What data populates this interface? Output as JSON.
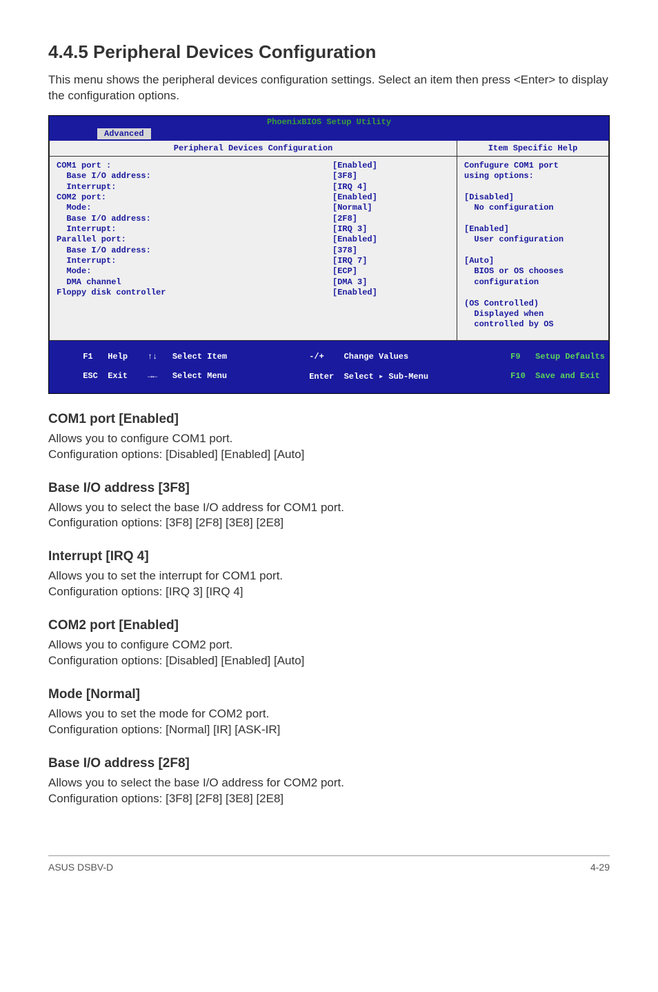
{
  "heading": "4.4.5      Peripheral Devices Configuration",
  "intro": "This menu shows the peripheral devices configuration settings.  Select an item then press <Enter> to display the configuration options.",
  "bios": {
    "title": "PhoenixBIOS Setup Utility",
    "tab": "Advanced",
    "left_header": "Peripheral Devices Configuration",
    "right_header": "Item Specific Help",
    "labels": "COM1 port :\n  Base I/O address:\n  Interrupt:\nCOM2 port:\n  Mode:\n  Base I/O address:\n  Interrupt:\nParallel port:\n  Base I/O address:\n  Interrupt:\n  Mode:\n  DMA channel\nFloppy disk controller",
    "values": "[Enabled]\n[3F8]\n[IRQ 4]\n[Enabled]\n[Normal]\n[2F8]\n[IRQ 3]\n[Enabled]\n[378]\n[IRQ 7]\n[ECP]\n[DMA 3]\n[Enabled]",
    "help": "Confugure COM1 port\nusing options:\n\n[Disabled]\n  No configuration\n\n[Enabled]\n  User configuration\n\n[Auto]\n  BIOS or OS chooses\n  configuration\n\n(OS Controlled)\n  Displayed when\n  controlled by OS",
    "footer": {
      "c1a": "F1   Help    ↑↓   Select Item",
      "c1b": "ESC  Exit    →←   Select Menu",
      "c2a": "-/+    Change Values",
      "c2b": "Enter  Select ▸ Sub-Menu",
      "c3a": "F9   Setup Defaults",
      "c3b": "F10  Save and Exit"
    }
  },
  "sections": [
    {
      "title": "COM1 port [Enabled]",
      "body": "Allows you to configure COM1 port.\nConfiguration options: [Disabled] [Enabled] [Auto]"
    },
    {
      "title": "Base I/O address [3F8]",
      "body": "Allows you to select the base I/O address for COM1 port.\nConfiguration options: [3F8] [2F8] [3E8] [2E8]"
    },
    {
      "title": "Interrupt [IRQ 4]",
      "body": "Allows you to set the interrupt for COM1 port.\nConfiguration options: [IRQ 3] [IRQ 4]"
    },
    {
      "title": "COM2 port [Enabled]",
      "body": "Allows you to configure COM2 port.\nConfiguration options: [Disabled] [Enabled] [Auto]"
    },
    {
      "title": "Mode [Normal]",
      "body": "Allows you to set the mode for COM2 port.\nConfiguration options: [Normal] [IR] [ASK-IR]"
    },
    {
      "title": "Base I/O address [2F8]",
      "body": "Allows you to select the base I/O address for COM2 port.\nConfiguration options: [3F8] [2F8] [3E8] [2E8]"
    }
  ],
  "footer_left": "ASUS DSBV-D",
  "footer_right": "4-29"
}
